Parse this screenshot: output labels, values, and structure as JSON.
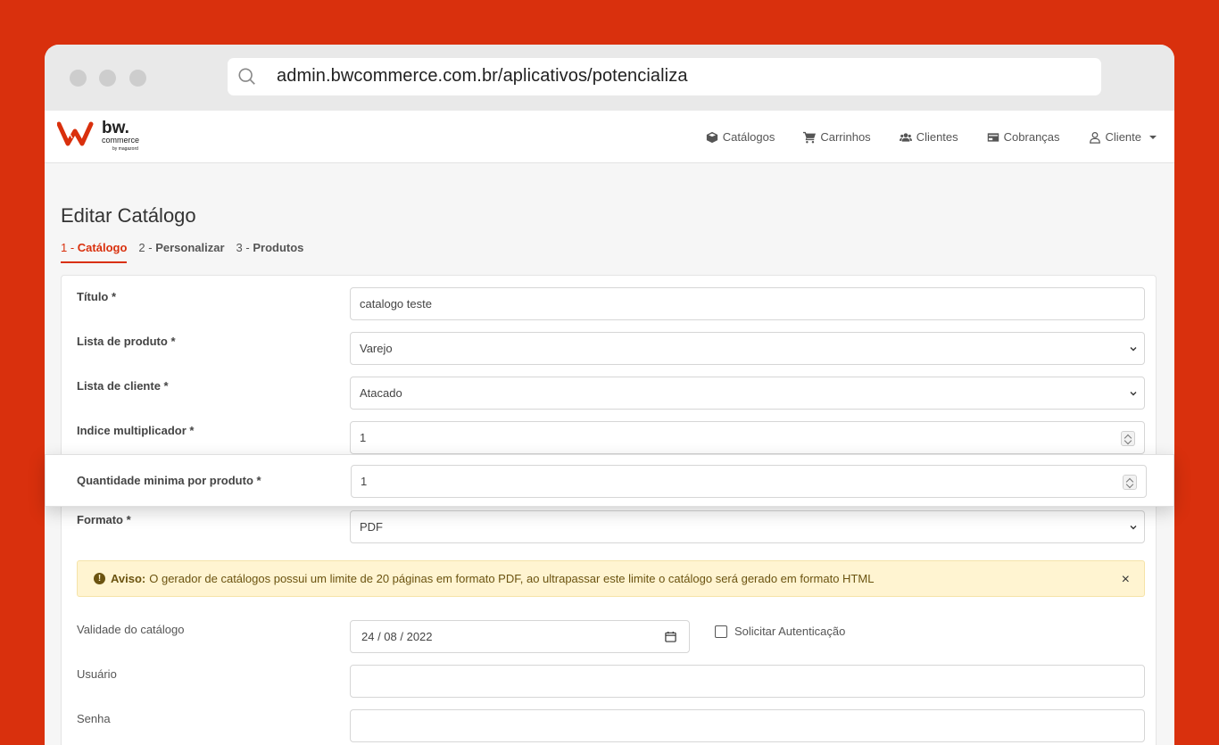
{
  "browser": {
    "url": "admin.bwcommerce.com.br/aplicativos/potencializa"
  },
  "logo": {
    "brand": "bw.",
    "sub": "commerce",
    "tag": "by magazord"
  },
  "nav": {
    "items": [
      {
        "label": "Catálogos",
        "icon": "cube-icon"
      },
      {
        "label": "Carrinhos",
        "icon": "cart-icon"
      },
      {
        "label": "Clientes",
        "icon": "users-icon"
      },
      {
        "label": "Cobranças",
        "icon": "card-icon"
      },
      {
        "label": "Cliente",
        "icon": "user-icon"
      }
    ]
  },
  "page": {
    "title": "Editar Catálogo",
    "tabs": [
      {
        "num": "1 - ",
        "label": "Catálogo"
      },
      {
        "num": "2 - ",
        "label": "Personalizar"
      },
      {
        "num": "3 - ",
        "label": "Produtos"
      }
    ]
  },
  "form": {
    "titulo": {
      "label": "Título *",
      "value": "catalogo teste"
    },
    "lista_produto": {
      "label": "Lista de produto *",
      "value": "Varejo"
    },
    "lista_cliente": {
      "label": "Lista de cliente *",
      "value": "Atacado"
    },
    "indice": {
      "label": "Indice multiplicador *",
      "value": "1"
    },
    "quantidade": {
      "label": "Quantidade minima por produto *",
      "value": "1"
    },
    "formato": {
      "label": "Formato *",
      "value": "PDF"
    },
    "validade": {
      "label": "Validade do catálogo",
      "value": "24 / 08 / 2022"
    },
    "autenticacao": {
      "label": "Solicitar Autenticação"
    },
    "usuario": {
      "label": "Usuário",
      "value": ""
    },
    "senha": {
      "label": "Senha",
      "value": ""
    }
  },
  "alert": {
    "strong": "Aviso:",
    "text": "O gerador de catálogos possui um limite de 20 páginas em formato PDF, ao ultrapassar este limite o catálogo será gerado em formato HTML",
    "close": "×"
  },
  "colors": {
    "accent": "#d9300d",
    "alert_bg": "#fff4d1"
  }
}
